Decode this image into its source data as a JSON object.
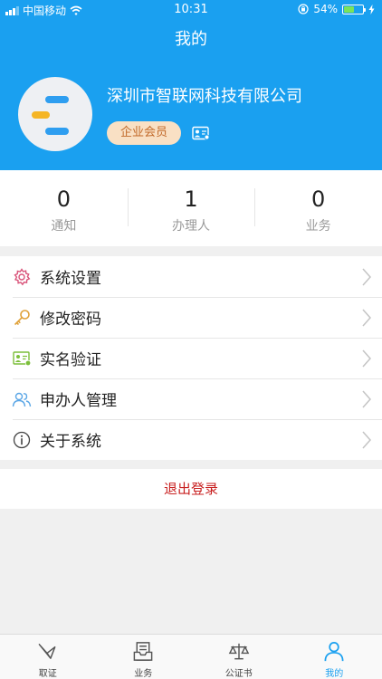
{
  "status_bar": {
    "carrier": "中国移动",
    "time": "10:31",
    "battery": "54%",
    "battery_level": 0.54,
    "icons": [
      "signal-icon",
      "wifi-icon",
      "rotation-lock-icon",
      "battery-icon",
      "charging-bolt-icon"
    ]
  },
  "nav": {
    "title": "我的"
  },
  "profile": {
    "company": "深圳市智联网科技有限公司",
    "badge": "企业会员",
    "icons": [
      "avatar-logo",
      "id-card-icon"
    ],
    "colors": {
      "header_bg": "#1aa0f0",
      "badge_bg": "#f9e0c4",
      "badge_text": "#c26a2a"
    }
  },
  "stats": [
    {
      "value": "0",
      "label": "通知"
    },
    {
      "value": "1",
      "label": "办理人"
    },
    {
      "value": "0",
      "label": "业务"
    }
  ],
  "menu": [
    {
      "label": "系统设置",
      "icon": "gear-icon"
    },
    {
      "label": "修改密码",
      "icon": "key-icon"
    },
    {
      "label": "实名验证",
      "icon": "id-verify-icon"
    },
    {
      "label": "申办人管理",
      "icon": "users-icon"
    },
    {
      "label": "关于系统",
      "icon": "info-icon"
    }
  ],
  "logout": {
    "label": "退出登录",
    "color": "#c82020"
  },
  "tabs": [
    {
      "label": "取证",
      "icon": "evidence-icon",
      "active": false
    },
    {
      "label": "业务",
      "icon": "business-icon",
      "active": false
    },
    {
      "label": "公证书",
      "icon": "scales-icon",
      "active": false
    },
    {
      "label": "我的",
      "icon": "person-icon",
      "active": true
    }
  ]
}
